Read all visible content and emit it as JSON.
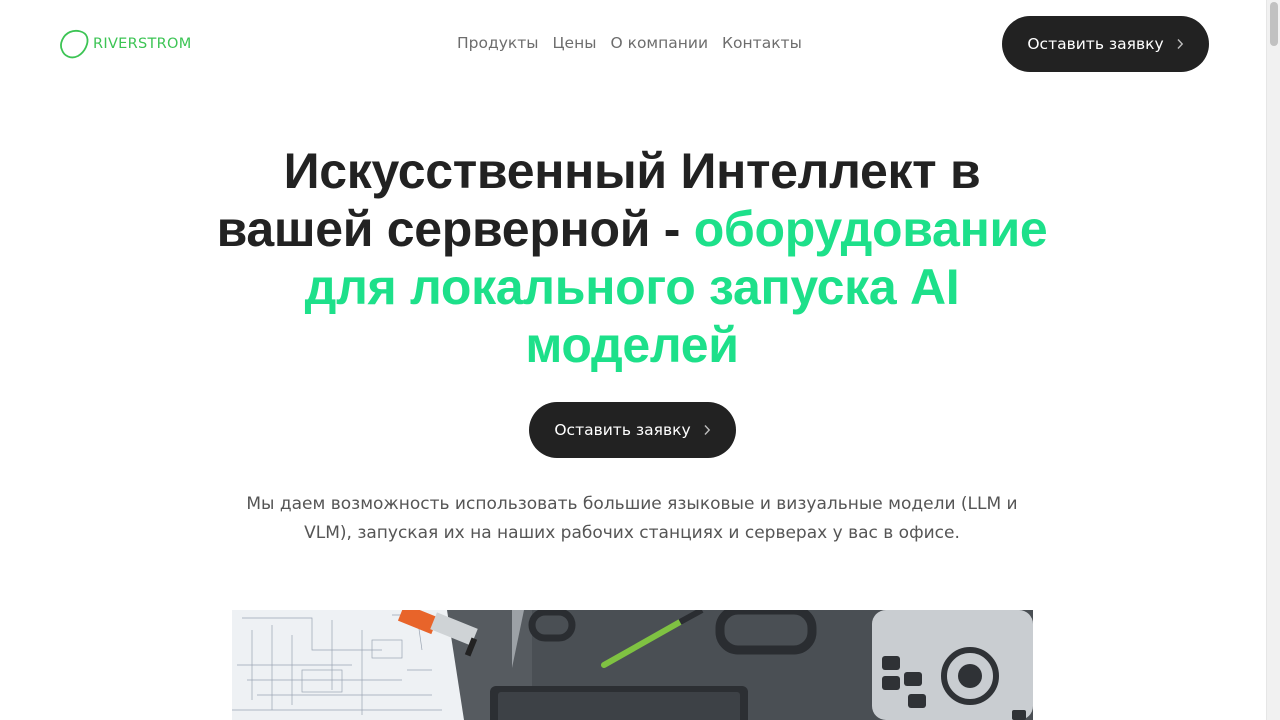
{
  "brand": {
    "name": "RIVERSTROM",
    "logo_color": "#3cc454"
  },
  "nav": {
    "items": [
      {
        "label": "Продукты"
      },
      {
        "label": "Цены"
      },
      {
        "label": "О компании"
      },
      {
        "label": "Контакты"
      }
    ]
  },
  "header": {
    "cta_label": "Оставить заявку",
    "cta_icon": "chevron-right-icon"
  },
  "hero": {
    "title_part1": "Искусственный Интеллект в вашей серверной - ",
    "title_part2": "оборудование для локального запуска AI моделей",
    "accent_color": "#1de08a",
    "cta_label": "Оставить заявку",
    "subtitle": "Мы даем возможность использовать большие языковые и визуальные модели (LLM и VLM), запуская их на наших рабочих станциях и серверах у вас в офисе."
  },
  "colors": {
    "text": "#222222",
    "button_bg": "#222222",
    "button_text": "#ffffff",
    "muted": "#555555"
  }
}
